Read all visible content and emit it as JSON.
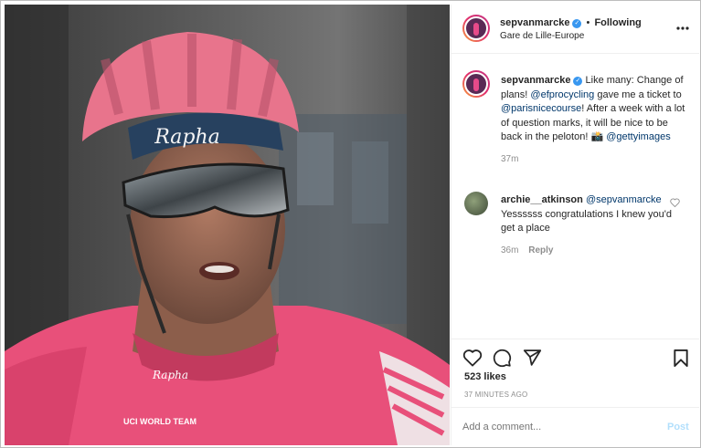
{
  "colors": {
    "accent": "#3897f0",
    "link": "#00376b",
    "muted": "#8e8e8e",
    "jersey": "#e8507a"
  },
  "post": {
    "author": "sepvanmarcke",
    "follow_dot": "•",
    "follow_status": "Following",
    "location": "Gare de Lille-Europe",
    "more_icon": "more-options-icon",
    "helmet_text": "Rapha",
    "sleeve_text": "Rapha",
    "jersey_badge": "UCI WORLD TEAM"
  },
  "caption": {
    "author": "sepvanmarcke",
    "text1": "Like many: Change of plans!",
    "mention1": "@efprocycling",
    "text2": "gave me a ticket to",
    "mention2": "@parisnicecourse",
    "text3": "! After a week with a lot of question marks, it will be nice to be back in the peloton! 📸",
    "mention3": "@gettyimages",
    "time": "37m"
  },
  "comment": {
    "author": "archie__atkinson",
    "mention": "@sepvanmarcke",
    "text": "Yessssss congratulations I knew you'd get a place",
    "time": "36m",
    "reply": "Reply"
  },
  "engagement": {
    "likes": "523 likes",
    "timestamp": "37 MINUTES AGO"
  },
  "add_comment": {
    "placeholder": "Add a comment...",
    "post_label": "Post"
  }
}
